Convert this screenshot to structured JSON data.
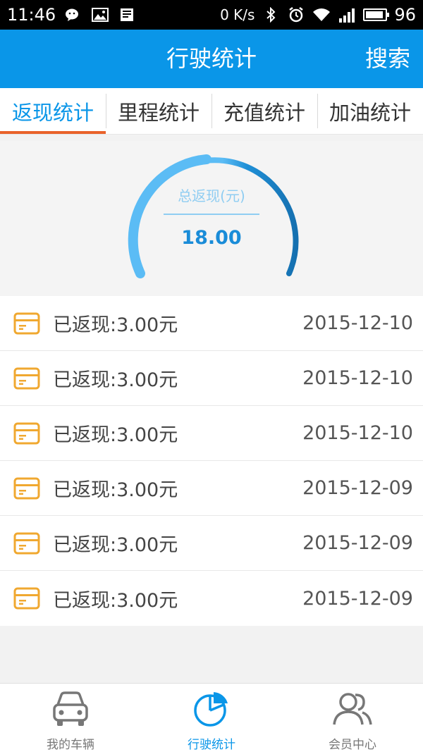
{
  "status_bar": {
    "time": "11:46",
    "net_speed": "0 K/s",
    "battery": "96",
    "left_icons": [
      "wechat-icon",
      "image-icon",
      "news-icon"
    ],
    "right_icons": [
      "bluetooth-icon",
      "alarm-icon",
      "wifi-icon",
      "signal-4g-icon",
      "battery-icon"
    ]
  },
  "header": {
    "title": "行驶统计",
    "search_label": "搜索",
    "color": "#0a96e8"
  },
  "tabs": [
    {
      "label": "返现统计",
      "active": true
    },
    {
      "label": "里程统计",
      "active": false
    },
    {
      "label": "充值统计",
      "active": false
    },
    {
      "label": "加油统计",
      "active": false
    }
  ],
  "gauge": {
    "label": "总返现(元)",
    "value": "18.00",
    "colors": {
      "light": "#5bbcf5",
      "dark": "#1570b0"
    }
  },
  "records": [
    {
      "text": "已返现:3.00元",
      "date": "2015-12-10"
    },
    {
      "text": "已返现:3.00元",
      "date": "2015-12-10"
    },
    {
      "text": "已返现:3.00元",
      "date": "2015-12-10"
    },
    {
      "text": "已返现:3.00元",
      "date": "2015-12-09"
    },
    {
      "text": "已返现:3.00元",
      "date": "2015-12-09"
    },
    {
      "text": "已返现:3.00元",
      "date": "2015-12-09"
    }
  ],
  "record_icon_color": "#f0a830",
  "bottom_nav": [
    {
      "label": "我的车辆",
      "icon": "car-icon",
      "active": false
    },
    {
      "label": "行驶统计",
      "icon": "pie-chart-icon",
      "active": true
    },
    {
      "label": "会员中心",
      "icon": "members-icon",
      "active": false
    }
  ]
}
